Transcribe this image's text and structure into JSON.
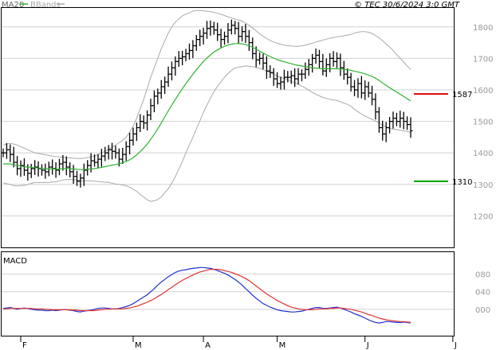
{
  "legend": {
    "ma_label": "MA20",
    "bb_label": "BBands",
    "ma_color": "#2fb12f",
    "bb_color": "#aaaaaa"
  },
  "copyright": "© TEC 30/6/2024 3:0 GMT",
  "macd_label": "MACD",
  "chart_data": [
    {
      "type": "line",
      "chart_kind": "bar (OHLC) price chart with MA20 and Bollinger Bands",
      "title": "",
      "y_ticks": [
        1200,
        1300,
        1400,
        1500,
        1600,
        1700,
        1800
      ],
      "y_tick_labels": [
        "1200",
        "1300",
        "1400",
        "1500",
        "1600",
        "1700",
        "1800"
      ],
      "ylim": [
        1100,
        1860
      ],
      "x_month_labels": [
        "F",
        "M",
        "A",
        "M",
        "J",
        "J"
      ],
      "x_month_bar_index": [
        5,
        37,
        57,
        78,
        103,
        128
      ],
      "levels": [
        {
          "label": "1587",
          "value": 1587,
          "color": "#dd0000"
        },
        {
          "label": "1310",
          "value": 1310,
          "color": "#00a000"
        }
      ],
      "grid": true,
      "bar_color": "#000000",
      "ohlc_closes": [
        1400,
        1410,
        1395,
        1370,
        1350,
        1360,
        1345,
        1335,
        1350,
        1355,
        1350,
        1345,
        1340,
        1355,
        1350,
        1345,
        1365,
        1370,
        1355,
        1340,
        1325,
        1310,
        1320,
        1345,
        1360,
        1375,
        1370,
        1380,
        1390,
        1400,
        1410,
        1405,
        1400,
        1380,
        1395,
        1420,
        1440,
        1460,
        1480,
        1500,
        1495,
        1520,
        1550,
        1580,
        1590,
        1610,
        1625,
        1650,
        1670,
        1690,
        1700,
        1705,
        1715,
        1725,
        1740,
        1760,
        1770,
        1780,
        1795,
        1800,
        1790,
        1775,
        1760,
        1770,
        1790,
        1805,
        1795,
        1770,
        1785,
        1770,
        1750,
        1715,
        1695,
        1700,
        1685,
        1660,
        1655,
        1635,
        1620,
        1625,
        1640,
        1640,
        1645,
        1635,
        1650,
        1650,
        1665,
        1680,
        1700,
        1710,
        1690,
        1660,
        1680,
        1700,
        1690,
        1700,
        1670,
        1650,
        1640,
        1610,
        1600,
        1620,
        1590,
        1610,
        1590,
        1570,
        1530,
        1480,
        1460,
        1480,
        1500,
        1510,
        1500,
        1510,
        1500,
        1490,
        1470
      ],
      "series": [
        {
          "name": "MA20",
          "color": "#2fb12f",
          "values": [
            1365,
            1365,
            1365,
            1362,
            1360,
            1358,
            1356,
            1355,
            1354,
            1353,
            1352,
            1351,
            1350,
            1349,
            1349,
            1348,
            1349,
            1350,
            1350,
            1350,
            1349,
            1348,
            1347,
            1347,
            1348,
            1349,
            1350,
            1352,
            1354,
            1356,
            1359,
            1361,
            1363,
            1366,
            1369,
            1373,
            1378,
            1385,
            1394,
            1404,
            1415,
            1428,
            1443,
            1459,
            1476,
            1495,
            1514,
            1533,
            1552,
            1570,
            1587,
            1604,
            1620,
            1635,
            1650,
            1664,
            1677,
            1690,
            1701,
            1711,
            1720,
            1727,
            1733,
            1738,
            1742,
            1745,
            1747,
            1747,
            1746,
            1744,
            1740,
            1735,
            1729,
            1723,
            1717,
            1711,
            1706,
            1701,
            1696,
            1692,
            1689,
            1686,
            1683,
            1680,
            1678,
            1676,
            1674,
            1672,
            1670,
            1669,
            1668,
            1667,
            1667,
            1667,
            1667,
            1667,
            1666,
            1665,
            1664,
            1662,
            1659,
            1657,
            1654,
            1651,
            1647,
            1643,
            1637,
            1630,
            1622,
            1614,
            1607,
            1600,
            1593,
            1586,
            1579,
            1572,
            1565
          ]
        },
        {
          "name": "BBands",
          "color": "#aaaaaa",
          "band": "upper",
          "values": [
            1425,
            1428,
            1430,
            1428,
            1425,
            1420,
            1415,
            1410,
            1405,
            1400,
            1398,
            1396,
            1394,
            1392,
            1390,
            1388,
            1387,
            1386,
            1385,
            1384,
            1383,
            1382,
            1382,
            1383,
            1385,
            1387,
            1390,
            1395,
            1400,
            1405,
            1412,
            1418,
            1425,
            1432,
            1440,
            1450,
            1465,
            1485,
            1510,
            1540,
            1570,
            1605,
            1640,
            1670,
            1700,
            1730,
            1755,
            1780,
            1800,
            1815,
            1825,
            1835,
            1840,
            1845,
            1850,
            1852,
            1852,
            1851,
            1850,
            1848,
            1846,
            1843,
            1840,
            1836,
            1832,
            1828,
            1825,
            1822,
            1818,
            1812,
            1805,
            1796,
            1787,
            1778,
            1770,
            1763,
            1757,
            1752,
            1748,
            1745,
            1742,
            1740,
            1739,
            1738,
            1738,
            1740,
            1742,
            1745,
            1748,
            1752,
            1755,
            1758,
            1761,
            1764,
            1766,
            1768,
            1770,
            1772,
            1774,
            1776,
            1780,
            1783,
            1785,
            1785,
            1783,
            1779,
            1773,
            1765,
            1756,
            1746,
            1736,
            1725,
            1712,
            1700,
            1688,
            1676,
            1665
          ]
        },
        {
          "name": "BBands",
          "color": "#aaaaaa",
          "band": "lower",
          "values": [
            1305,
            1302,
            1300,
            1296,
            1295,
            1296,
            1297,
            1300,
            1303,
            1306,
            1306,
            1306,
            1306,
            1306,
            1308,
            1308,
            1311,
            1314,
            1315,
            1316,
            1315,
            1314,
            1312,
            1311,
            1311,
            1311,
            1310,
            1309,
            1308,
            1307,
            1306,
            1304,
            1301,
            1300,
            1298,
            1296,
            1291,
            1285,
            1278,
            1268,
            1260,
            1251,
            1246,
            1248,
            1252,
            1260,
            1273,
            1286,
            1304,
            1325,
            1349,
            1373,
            1400,
            1425,
            1450,
            1476,
            1502,
            1529,
            1552,
            1574,
            1594,
            1611,
            1626,
            1640,
            1652,
            1662,
            1669,
            1672,
            1674,
            1676,
            1675,
            1674,
            1671,
            1668,
            1664,
            1659,
            1655,
            1650,
            1644,
            1639,
            1636,
            1632,
            1627,
            1622,
            1618,
            1612,
            1606,
            1599,
            1592,
            1586,
            1581,
            1576,
            1573,
            1570,
            1568,
            1566,
            1562,
            1558,
            1554,
            1548,
            1538,
            1531,
            1523,
            1517,
            1511,
            1507,
            1501,
            1495,
            1488,
            1482,
            1478,
            1475,
            1474,
            1472,
            1470,
            1468,
            1465
          ]
        }
      ]
    },
    {
      "type": "line",
      "title": "MACD",
      "y_ticks": [
        0,
        40,
        80
      ],
      "y_tick_labels": [
        "000",
        "040",
        "080"
      ],
      "ylim": [
        -60,
        130
      ],
      "x_month_labels": [
        "F",
        "M",
        "A",
        "M",
        "J",
        "J"
      ],
      "grid": true,
      "series": [
        {
          "name": "MACD",
          "color": "#2030d0",
          "values": [
            2,
            3,
            4,
            2,
            0,
            2,
            3,
            2,
            0,
            -1,
            -2,
            -2,
            -3,
            -3,
            -2,
            -3,
            -2,
            -1,
            -1,
            -2,
            -3,
            -5,
            -6,
            -4,
            -3,
            -2,
            0,
            2,
            3,
            3,
            2,
            1,
            1,
            2,
            4,
            6,
            9,
            13,
            18,
            23,
            28,
            33,
            40,
            47,
            55,
            62,
            68,
            74,
            79,
            84,
            87,
            89,
            90,
            92,
            93,
            94,
            95,
            95,
            94,
            93,
            91,
            88,
            85,
            82,
            78,
            73,
            68,
            62,
            55,
            47,
            40,
            32,
            25,
            19,
            13,
            9,
            5,
            2,
            -1,
            -3,
            -4,
            -5,
            -6,
            -6,
            -5,
            -4,
            -2,
            0,
            2,
            4,
            4,
            2,
            2,
            3,
            4,
            5,
            3,
            0,
            -3,
            -6,
            -10,
            -13,
            -16,
            -20,
            -24,
            -27,
            -30,
            -31,
            -30,
            -28,
            -28,
            -29,
            -30,
            -30,
            -29,
            -30,
            -31
          ]
        },
        {
          "name": "Signal",
          "color": "#e03030",
          "values": [
            1,
            1,
            2,
            2,
            2,
            2,
            2,
            2,
            2,
            1,
            1,
            1,
            0,
            0,
            -1,
            -1,
            -1,
            -1,
            -1,
            -1,
            -2,
            -2,
            -3,
            -3,
            -3,
            -3,
            -3,
            -2,
            -1,
            0,
            0,
            1,
            1,
            1,
            1,
            2,
            3,
            5,
            7,
            10,
            13,
            16,
            20,
            24,
            29,
            34,
            39,
            45,
            50,
            56,
            61,
            66,
            70,
            74,
            78,
            82,
            85,
            87,
            89,
            91,
            91,
            91,
            90,
            88,
            86,
            84,
            81,
            78,
            74,
            70,
            65,
            59,
            53,
            47,
            41,
            35,
            30,
            25,
            20,
            16,
            12,
            8,
            5,
            3,
            1,
            0,
            -1,
            -1,
            -1,
            0,
            1,
            1,
            1,
            2,
            2,
            3,
            3,
            2,
            1,
            0,
            -2,
            -4,
            -6,
            -9,
            -12,
            -14,
            -17,
            -20,
            -22,
            -24,
            -25,
            -26,
            -27,
            -28,
            -28,
            -29,
            -30
          ]
        }
      ]
    }
  ]
}
